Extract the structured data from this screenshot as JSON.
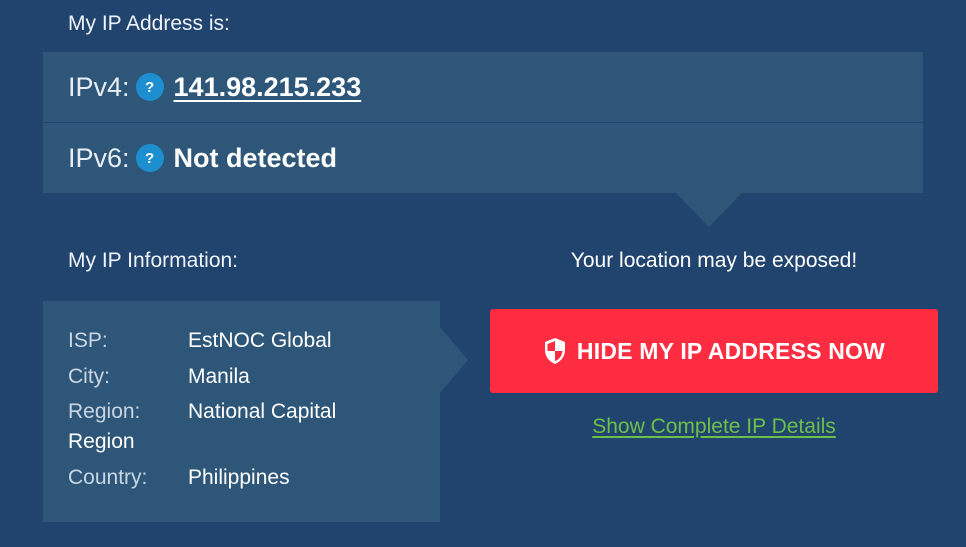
{
  "ip_section": {
    "heading": "My IP Address is:",
    "ipv4": {
      "label": "IPv4:",
      "help": "?",
      "value": "141.98.215.233"
    },
    "ipv6": {
      "label": "IPv6:",
      "help": "?",
      "value": "Not detected"
    }
  },
  "info_section": {
    "heading": "My IP Information:",
    "isp": {
      "label": "ISP:",
      "value": "EstNOC Global"
    },
    "city": {
      "label": "City:",
      "value": "Manila"
    },
    "region": {
      "label": "Region:",
      "value_line1": "National Capital",
      "value_line2": "Region"
    },
    "country": {
      "label": "Country:",
      "value": "Philippines"
    }
  },
  "action": {
    "warning": "Your location may be exposed!",
    "hide_button_label": "HIDE MY IP ADDRESS NOW",
    "shield_icon": "shield-icon",
    "details_link": "Show Complete IP Details"
  },
  "colors": {
    "background": "#21446e",
    "panel": "#2d5679",
    "accent_blue": "#1d8fd0",
    "button_red": "#fd2c40",
    "link_green": "#6cc04a"
  }
}
